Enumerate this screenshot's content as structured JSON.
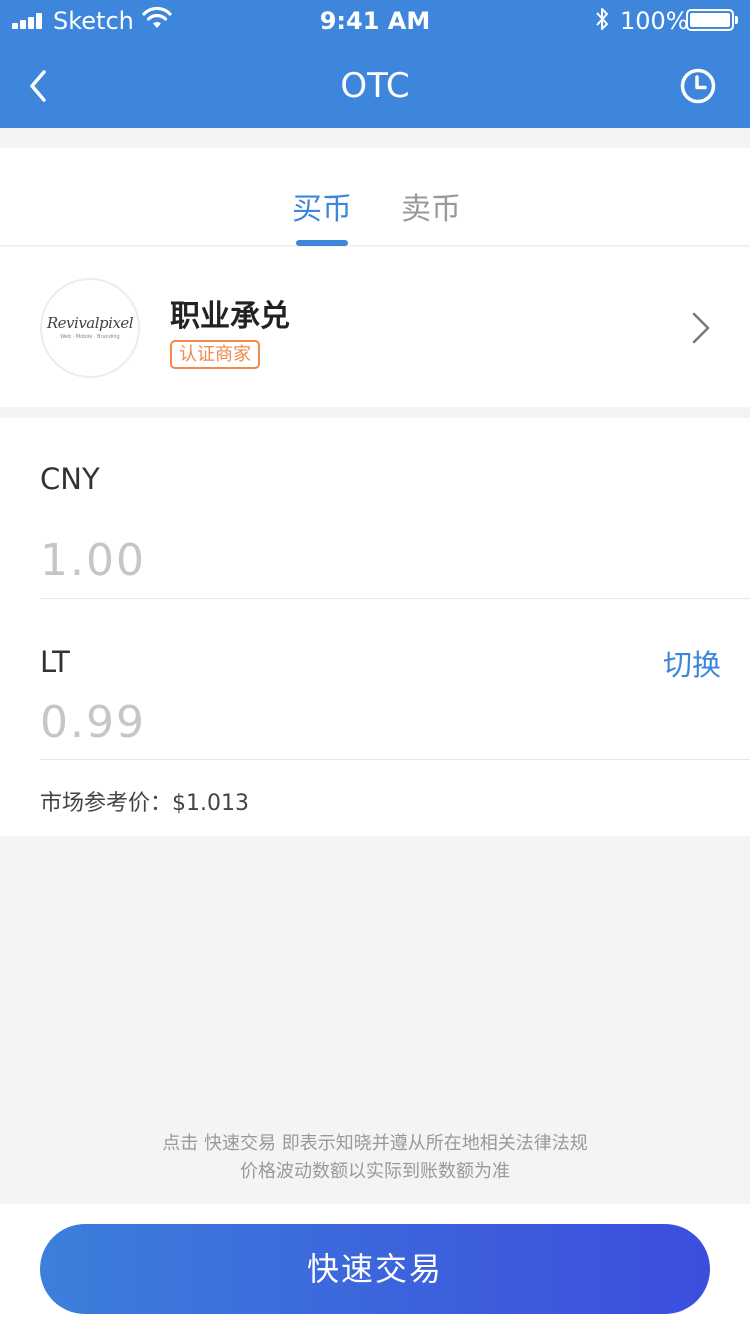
{
  "status_bar": {
    "carrier": "Sketch",
    "time": "9:41 AM",
    "battery": "100%"
  },
  "nav": {
    "title": "OTC",
    "back_icon": "chevron-left-icon",
    "history_icon": "clock-icon"
  },
  "tabs": [
    {
      "label": "买币",
      "active": true
    },
    {
      "label": "卖币",
      "active": false
    }
  ],
  "merchant": {
    "logo_text": "Revivalpixel",
    "logo_subtext": "Web · Mobile · Branding",
    "name": "职业承兑",
    "badge": "认证商家"
  },
  "form": {
    "cny_label": "CNY",
    "cny_value": "1.00",
    "lt_label": "LT",
    "lt_value": "0.99",
    "switch_label": "切换",
    "reference_price": "市场参考价：$1.013"
  },
  "disclaimer": {
    "line1": "点击 快速交易 即表示知晓并遵从所在地相关法律法规",
    "line2": "价格波动数额以实际到账数额为准"
  },
  "action": {
    "label": "快速交易"
  },
  "colors": {
    "primary": "#3d86dc",
    "badge": "#f0894a",
    "background": "#f4f4f4"
  }
}
